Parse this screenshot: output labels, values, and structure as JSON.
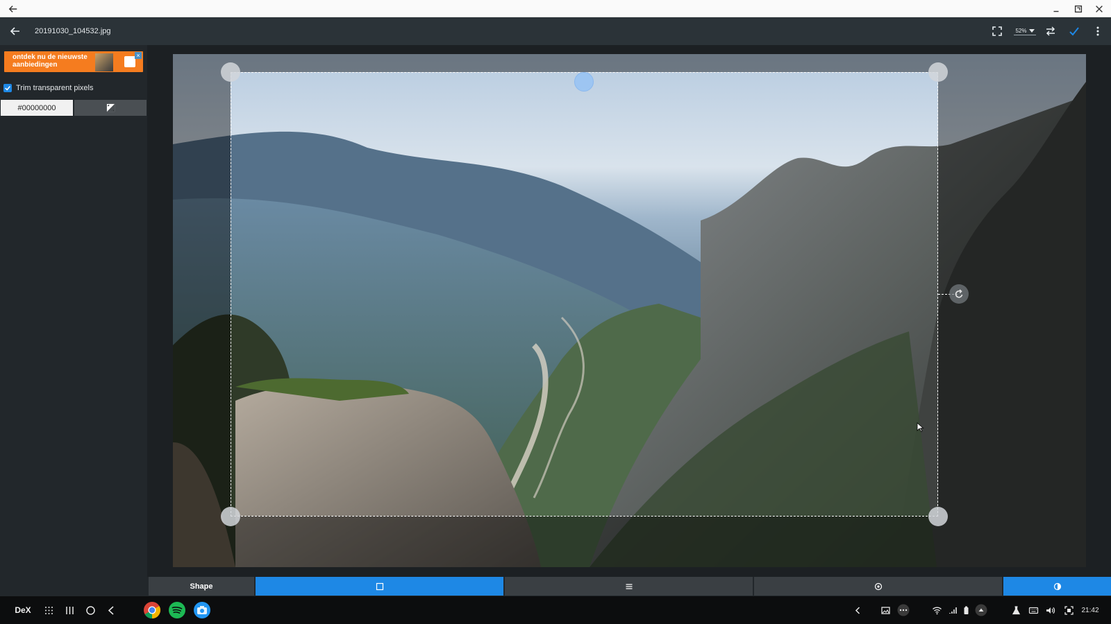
{
  "window": {
    "back_icon": "arrow-left-icon",
    "controls": [
      "minimize-icon",
      "maximize-icon",
      "close-icon"
    ]
  },
  "toolbar": {
    "file_name": "20191030_104532.jpg",
    "zoom": "52%",
    "icons": [
      "fullscreen-icon",
      "swap-icon",
      "check-icon",
      "more-vert-icon"
    ],
    "accent": "#1e88e5"
  },
  "sidebar": {
    "ad_text": "ontdek nu de nieuwste aanbiedingen",
    "trim_label": "Trim transparent pixels",
    "trim_checked": true,
    "color_value": "#00000000"
  },
  "crop": {
    "icons": [
      "rotate-icon"
    ]
  },
  "tabs": {
    "shape_label": "Shape",
    "items": [
      "square-icon",
      "menu-icon",
      "circle-icon",
      "contrast-icon"
    ],
    "active_color": "#1e88e5"
  },
  "taskbar": {
    "dex_label": "DeX",
    "apps": [
      "chrome-icon",
      "spotify-icon",
      "camera-icon"
    ],
    "time": "21:42"
  }
}
